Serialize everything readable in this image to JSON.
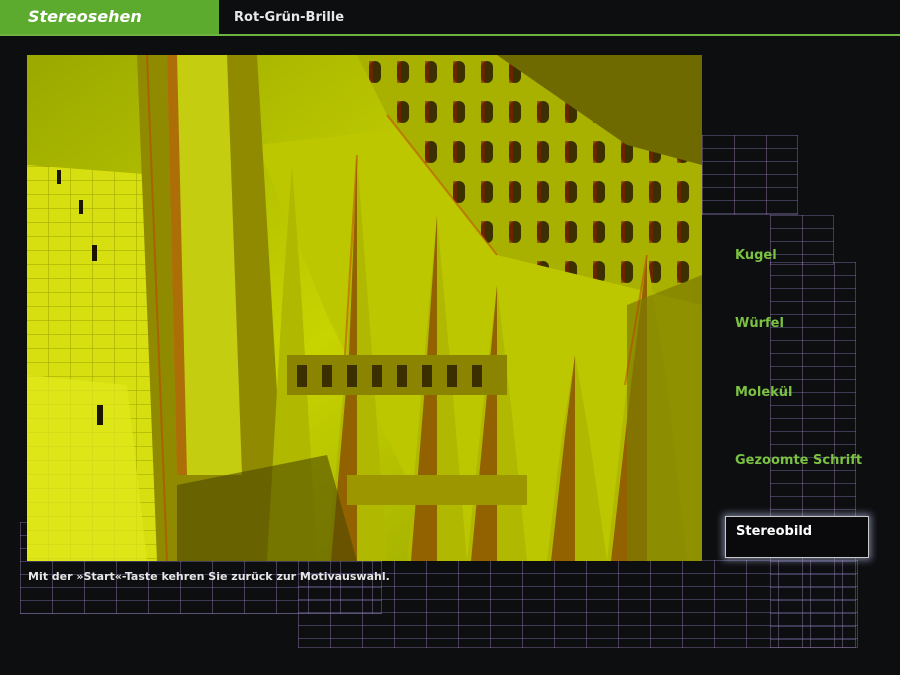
{
  "header": {
    "title": "Stereosehen",
    "subtitle": "Rot-Grün-Brille"
  },
  "caption": "Mit der »Start«-Taste kehren Sie zurück zur Motivauswahl.",
  "menu": {
    "items": [
      {
        "label": "Kugel"
      },
      {
        "label": "Würfel"
      },
      {
        "label": "Molekül"
      },
      {
        "label": "Gezoomte Schrift"
      },
      {
        "label": "Stereobild",
        "active": true
      }
    ]
  },
  "colors": {
    "accent_green": "#5cab2e",
    "menu_text": "#7bc242",
    "background": "#0d0e10"
  }
}
